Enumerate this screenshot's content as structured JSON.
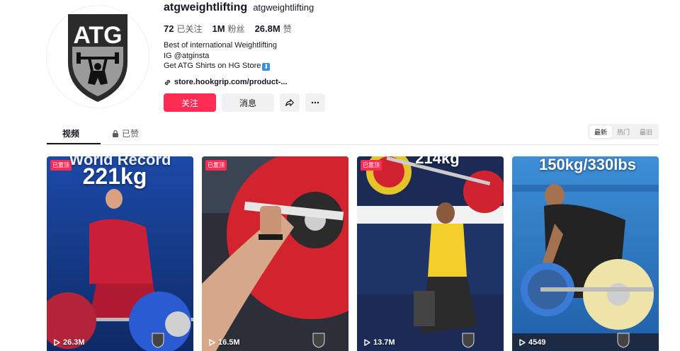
{
  "profile": {
    "handle": "atgweightlifting",
    "nickname": "atgweightlifting",
    "avatar_text": "ATG",
    "stats": [
      {
        "value": "72",
        "label": "已关注"
      },
      {
        "value": "1M",
        "label": "粉丝"
      },
      {
        "value": "26.8M",
        "label": "赞"
      }
    ],
    "bio": [
      "Best of international Weightlifting",
      "IG @atginsta",
      "Get ATG Shirts on HG Store"
    ],
    "link": "store.hookgrip.com/product-..."
  },
  "actions": {
    "follow_label": "关注",
    "message_label": "消息",
    "share_icon": "share-icon",
    "more_icon": "more-icon"
  },
  "tabs": {
    "videos": "视频",
    "liked": "已赞"
  },
  "sort": {
    "options": [
      "最新",
      "热门",
      "最旧"
    ],
    "selected": "最新"
  },
  "videos": [
    {
      "pinned": "已置顶",
      "overlay_top": "World Record",
      "overlay_main": "221kg",
      "views": "26.3M"
    },
    {
      "pinned": "已置顶",
      "overlay_top": "",
      "overlay_main": "",
      "views": "16.5M"
    },
    {
      "pinned": "已置顶",
      "overlay_top": "",
      "overlay_main": "214kg",
      "views": "13.7M"
    },
    {
      "pinned": "",
      "overlay_top": "",
      "overlay_main": "150kg/330lbs",
      "views": "4549"
    }
  ],
  "colors": {
    "accent": "#fe2c55",
    "text": "#161823",
    "muted": "#5c5d63"
  }
}
